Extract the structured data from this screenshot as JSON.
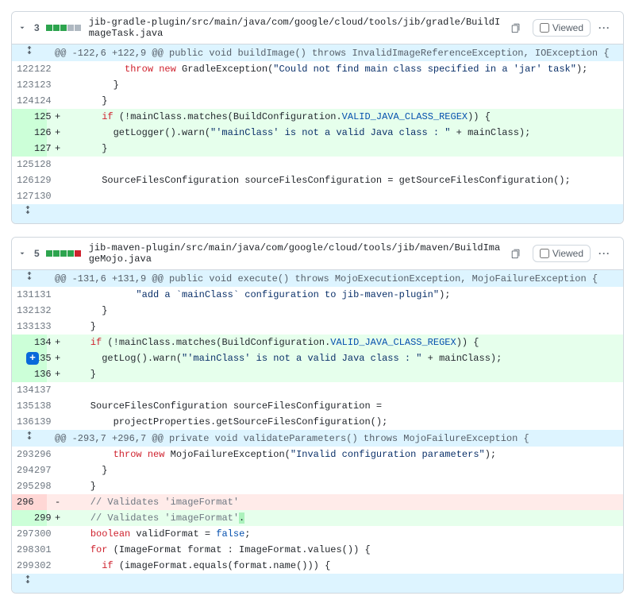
{
  "ui": {
    "viewed_label": "Viewed",
    "kebab": "···"
  },
  "files": [
    {
      "changes": "3",
      "squares": [
        "add",
        "add",
        "add",
        "neu",
        "neu"
      ],
      "path": "jib-gradle-plugin/src/main/java/com/google/cloud/tools/jib/gradle/BuildImageTask.java",
      "hunk1": "@@ -122,6 +122,9 @@ public void buildImage() throws InvalidImageReferenceException, IOException {",
      "l122": {
        "pre": "          ",
        "kw1": "throw",
        "kw2": " new",
        "rest": " GradleException(",
        "str": "\"Could not find main class specified in a 'jar' task\"",
        "tail": ");"
      },
      "l123": "        }",
      "l124": "      }",
      "a125": {
        "pre": "      ",
        "kw": "if",
        "rest1": " (!mainClass.matches(BuildConfiguration.",
        "const": "VALID_JAVA_CLASS_REGEX",
        "rest2": ")) {"
      },
      "a126": {
        "pre": "        getLogger().warn(",
        "str": "\"'mainClass' is not a valid Java class : \"",
        "rest": " + mainClass);"
      },
      "a127": "      }",
      "l125b": "",
      "l126b": "      SourceFilesConfiguration sourceFilesConfiguration = getSourceFilesConfiguration();",
      "l127b": ""
    },
    {
      "changes": "5",
      "squares": [
        "add",
        "add",
        "add",
        "add",
        "del"
      ],
      "path": "jib-maven-plugin/src/main/java/com/google/cloud/tools/jib/maven/BuildImageMojo.java",
      "hunk1": "@@ -131,6 +131,9 @@ public void execute() throws MojoExecutionException, MojoFailureException {",
      "l131": {
        "pre": "            ",
        "str": "\"add a `mainClass` configuration to jib-maven-plugin\"",
        "tail": ");"
      },
      "l132": "      }",
      "l133": "    }",
      "a134": {
        "pre": "    ",
        "kw": "if",
        "rest1": " (!mainClass.matches(BuildConfiguration.",
        "const": "VALID_JAVA_CLASS_REGEX",
        "rest2": ")) {"
      },
      "a135": {
        "pre": "      getLog().warn(",
        "str": "\"'mainClass' is not a valid Java class : \"",
        "rest": " + mainClass);"
      },
      "a136": "    }",
      "l134b": "",
      "l135b": "    SourceFilesConfiguration sourceFilesConfiguration =",
      "l136b": "        projectProperties.getSourceFilesConfiguration();",
      "hunk2": "@@ -293,7 +296,7 @@ private void validateParameters() throws MojoFailureException {",
      "l293": {
        "pre": "        ",
        "kw1": "throw",
        "kw2": " new",
        "rest": " MojoFailureException(",
        "str": "\"Invalid configuration parameters\"",
        "tail": ");"
      },
      "l294": "      }",
      "l295": "    }",
      "d296": "    // Validates 'imageFormat'",
      "a299": {
        "pre": "    ",
        "c": "// Validates 'imageFormat'",
        "dot": "."
      },
      "l297": {
        "pre": "    ",
        "kw": "boolean",
        "rest": " validFormat = ",
        "val": "false",
        "tail": ";"
      },
      "l298": {
        "pre": "    ",
        "kw": "for",
        "rest": " (ImageFormat format : ImageFormat.values()) {"
      },
      "l299": {
        "pre": "      ",
        "kw": "if",
        "rest": " (imageFormat.equals(format.name())) {"
      }
    }
  ]
}
